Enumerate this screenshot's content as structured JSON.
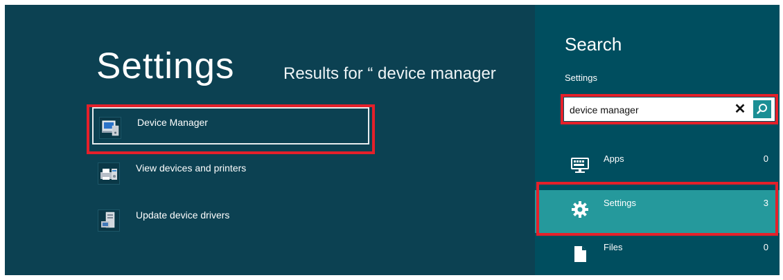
{
  "results": {
    "title": "Settings",
    "query_caption": "Results for “ device manager",
    "items": [
      {
        "label": "Device Manager",
        "icon": "device-manager-icon",
        "selected": true
      },
      {
        "label": "View devices and printers",
        "icon": "devices-printers-icon",
        "selected": false
      },
      {
        "label": "Update device drivers",
        "icon": "update-drivers-icon",
        "selected": false
      }
    ]
  },
  "search": {
    "title": "Search",
    "scope": "Settings",
    "query": "device manager",
    "clear_glyph": "✕",
    "scopes": [
      {
        "label": "Apps",
        "count": "0",
        "icon": "apps-keyboard-icon",
        "active": false
      },
      {
        "label": "Settings",
        "count": "3",
        "icon": "gear-icon",
        "active": true
      },
      {
        "label": "Files",
        "count": "0",
        "icon": "file-icon",
        "active": false
      }
    ]
  },
  "colors": {
    "background": "#0c4152",
    "search_pane": "#004e5f",
    "active_scope": "#25999c",
    "search_button": "#1c8f95",
    "annotation_red": "#e5202a"
  }
}
